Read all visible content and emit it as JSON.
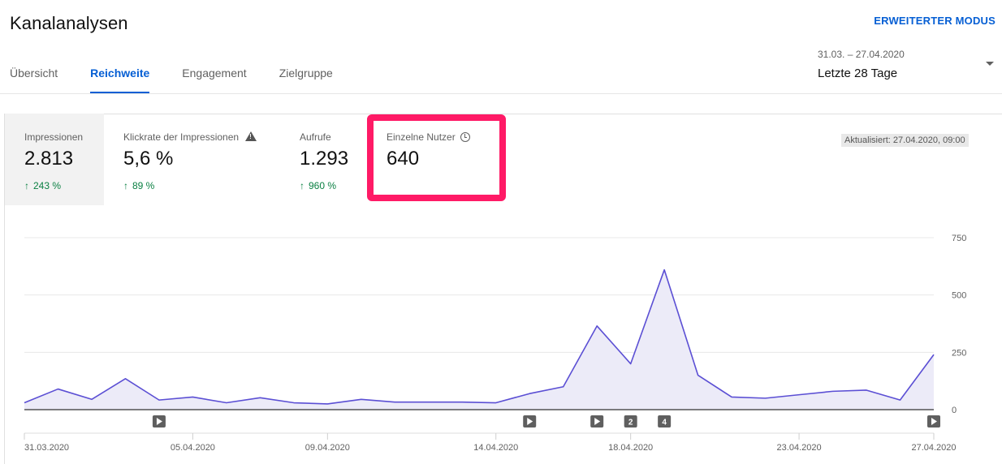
{
  "header": {
    "title": "Kanalanalysen",
    "advanced_mode": "ERWEITERTER MODUS",
    "date_range": "31.03. – 27.04.2020",
    "date_label": "Letzte 28 Tage"
  },
  "tabs": [
    {
      "label": "Übersicht",
      "active": false
    },
    {
      "label": "Reichweite",
      "active": true
    },
    {
      "label": "Engagement",
      "active": false
    },
    {
      "label": "Zielgruppe",
      "active": false
    }
  ],
  "metrics": [
    {
      "title": "Impressionen",
      "value": "2.813",
      "change": "243 %",
      "selected": true
    },
    {
      "title": "Klickrate der Impressionen",
      "value": "5,6 %",
      "change": "89 %",
      "icon": "warning-icon"
    },
    {
      "title": "Aufrufe",
      "value": "1.293",
      "change": "960 %"
    },
    {
      "title": "Einzelne Nutzer",
      "value": "640",
      "icon": "clock-icon",
      "highlighted": true
    }
  ],
  "updated": "Aktualisiert: 27.04.2020, 09:00",
  "colors": {
    "accent": "#065fd4",
    "positive": "#0b8043",
    "highlight": "#ff1a66",
    "line": "#5b4fd4",
    "fill": "#ecebf8"
  },
  "chart_data": {
    "type": "area",
    "x": [
      "31.03.2020",
      "01.04.2020",
      "02.04.2020",
      "03.04.2020",
      "04.04.2020",
      "05.04.2020",
      "06.04.2020",
      "07.04.2020",
      "08.04.2020",
      "09.04.2020",
      "10.04.2020",
      "11.04.2020",
      "12.04.2020",
      "13.04.2020",
      "14.04.2020",
      "15.04.2020",
      "16.04.2020",
      "17.04.2020",
      "18.04.2020",
      "19.04.2020",
      "20.04.2020",
      "21.04.2020",
      "22.04.2020",
      "23.04.2020",
      "24.04.2020",
      "25.04.2020",
      "26.04.2020",
      "27.04.2020"
    ],
    "series": [
      {
        "values": [
          30,
          90,
          45,
          135,
          42,
          55,
          30,
          52,
          30,
          25,
          45,
          33,
          33,
          33,
          30,
          70,
          100,
          365,
          200,
          610,
          150,
          55,
          50,
          65,
          80,
          85,
          42,
          240
        ]
      }
    ],
    "x_tick_labels": [
      "31.03.2020",
      "05.04.2020",
      "09.04.2020",
      "14.04.2020",
      "18.04.2020",
      "23.04.2020",
      "27.04.2020"
    ],
    "x_tick_indices": [
      0,
      5,
      9,
      14,
      18,
      23,
      27
    ],
    "y_ticks": [
      "0",
      "250",
      "500",
      "750"
    ],
    "ylim": [
      0,
      750
    ],
    "grid": true,
    "markers": [
      {
        "index": 4,
        "label": "",
        "type": "video"
      },
      {
        "index": 15,
        "label": "",
        "type": "video"
      },
      {
        "index": 17,
        "label": "",
        "type": "video"
      },
      {
        "index": 18,
        "label": "2",
        "type": "count"
      },
      {
        "index": 19,
        "label": "4",
        "type": "count"
      },
      {
        "index": 27,
        "label": "",
        "type": "video"
      }
    ]
  }
}
